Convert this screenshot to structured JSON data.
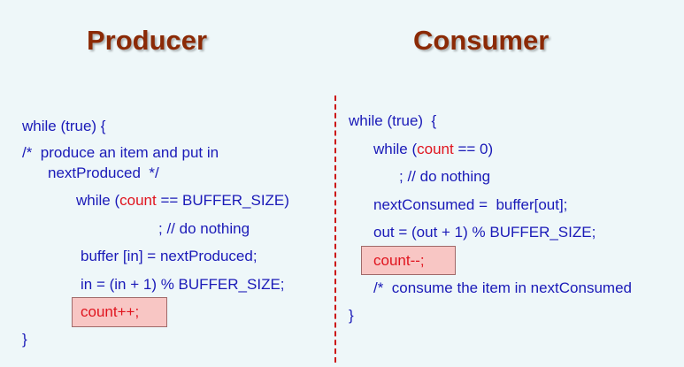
{
  "producer": {
    "title": "Producer",
    "lines": {
      "l1": "while (true) {",
      "l2": "/*  produce an item and put in",
      "l3": "nextProduced  */",
      "l4_pre": "while (",
      "l4_count": "count",
      "l4_post": " == BUFFER_SIZE)",
      "l5": "; // do nothing",
      "l6": "buffer [in] = nextProduced;",
      "l7": "in = (in + 1) % BUFFER_SIZE;",
      "l8_count": "count",
      "l8_op": "++;",
      "l9": "}"
    }
  },
  "consumer": {
    "title": "Consumer",
    "lines": {
      "l1": "while (true)  {",
      "l2_pre": "while (",
      "l2_count": "count",
      "l2_post": " == 0)",
      "l3": "; // do nothing",
      "l4": "nextConsumed =  buffer[out];",
      "l5": "out = (out + 1) % BUFFER_SIZE;",
      "l6_count": "count",
      "l6_op": "--;",
      "l7": "/*  consume the item in nextConsumed",
      "l8": "}"
    }
  },
  "colors": {
    "title": "#8b2a06",
    "code": "#1a1ab8",
    "count_keyword": "#e0141e",
    "highlight_box": "#f8c6c4",
    "divider": "#cc1010",
    "background": "#eef7f9"
  }
}
